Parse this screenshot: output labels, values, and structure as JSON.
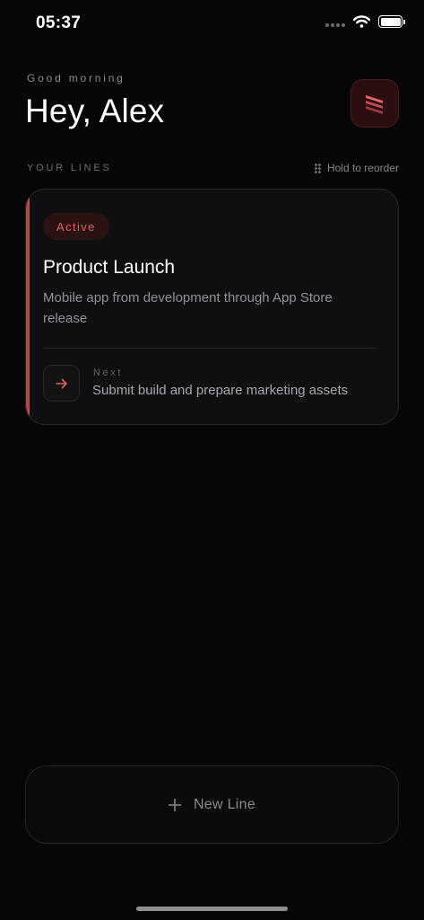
{
  "status_bar": {
    "time": "05:37",
    "icons": [
      "signal-dots-icon",
      "wifi-icon",
      "battery-icon"
    ]
  },
  "header": {
    "greeting": "Good morning",
    "title": "Hey, Alex",
    "logo_icon": "stacked-lines-logo-icon"
  },
  "section": {
    "label": "YOUR LINES",
    "reorder_hint": "Hold to reorder",
    "reorder_icon": "drag-handle-icon"
  },
  "lines": [
    {
      "status": "Active",
      "title": "Product Launch",
      "description": "Mobile app from development through App Store release",
      "next_label": "Next",
      "next_text": "Submit build and prepare marketing assets",
      "next_icon": "arrow-right-icon"
    }
  ],
  "new_line": {
    "label": "New Line",
    "icon": "plus-icon"
  },
  "colors": {
    "background": "#060608",
    "accent": "#b04a48",
    "badge_text": "#e0605e",
    "card_background": "#0f0f12"
  }
}
